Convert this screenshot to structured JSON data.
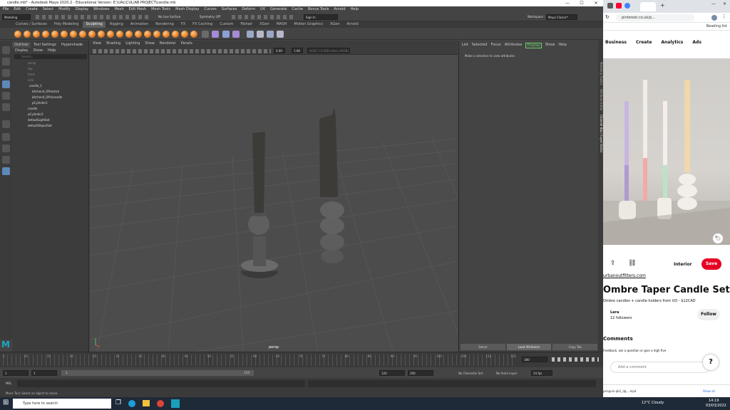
{
  "maya": {
    "title": "candle.mb* - Autodesk Maya 2020.2 - Educational Version: E:\\UAL\\CUL\\AB PROJECT\\candle.mb",
    "menubar": [
      "File",
      "Edit",
      "Create",
      "Select",
      "Modify",
      "Display",
      "Windows",
      "Mesh",
      "Edit Mesh",
      "Mesh Tools",
      "Mesh Display",
      "Curves",
      "Surfaces",
      "Deform",
      "UV",
      "Generate",
      "Cache",
      "Bonus Tools",
      "Arnold",
      "Help"
    ],
    "status": {
      "mode": "Modeling",
      "live_surface": "No Live Surface",
      "symmetry": "Symmetry: Off",
      "signin": "Sign In",
      "workspace_label": "Workspace :",
      "workspace": "Maya Classic*"
    },
    "shelf_tabs": [
      "Curves / Surfaces",
      "Poly Modeling",
      "Sculpting",
      "Rigging",
      "Animation",
      "Rendering",
      "FX",
      "FX Caching",
      "Custom",
      "Fibhair",
      "XGen",
      "MASH",
      "Motion Graphics",
      "XGen",
      "Arnold"
    ],
    "shelf_active": 2,
    "outliner": {
      "tabs": [
        "Outliner",
        "Tool Settings",
        "Hypershade"
      ],
      "menu": [
        "Display",
        "Show",
        "Help"
      ],
      "search_placeholder": "Search...",
      "items": [
        "persp",
        "top",
        "front",
        "side",
        "candle_1",
        "kitchen4_Ofirkstick",
        "kitchen4_Ofirkcandle",
        "pCylinder1",
        "candle",
        "pCylinder2",
        "defaultLightSet",
        "defaultObjectSet"
      ]
    },
    "viewport": {
      "menu": [
        "View",
        "Shading",
        "Lighting",
        "Show",
        "Renderer",
        "Panels"
      ],
      "camera_label": "persp",
      "field1": "0.00",
      "field2": "1.00",
      "colorspace": "ACES 1.0 SDR-video (sRGB)"
    },
    "attribute_editor": {
      "tabs": [
        "List",
        "Selected",
        "Focus",
        "Attributes",
        "Display",
        "Show",
        "Help"
      ],
      "active_tab": 4,
      "message": "Make a selection to view attributes",
      "buttons": [
        "Select",
        "Load Attributes",
        "Copy Tab"
      ]
    },
    "right_tabs": [
      "Modeling Toolkit",
      "Attribute Editor",
      "Channel Box / Layer Editor"
    ],
    "timeline": {
      "ticks": [
        "5",
        "10",
        "15",
        "20",
        "25",
        "30",
        "35",
        "40",
        "45",
        "50",
        "55",
        "60",
        "65",
        "70",
        "75",
        "80",
        "85",
        "90",
        "95",
        "100",
        "105",
        "110",
        "115"
      ],
      "current_frame": "180"
    },
    "range": {
      "start": "1",
      "start2": "1",
      "mid": "1",
      "end_inner": "120",
      "end1": "120",
      "end2": "200",
      "character_set": "No Character Set",
      "anim_layer": "No Anim Layer",
      "fps": "24 fps"
    },
    "mel_label": "MEL",
    "help_line": "Move Tool: Select an object to move."
  },
  "browser": {
    "omnibox": "pinterest.co.uk/p...",
    "reading_list": "Reading list",
    "nav": [
      "Business",
      "Create",
      "Analytics",
      "Ads"
    ],
    "interior": "Interior",
    "save": "Save",
    "source": "urbanoutfitters.com",
    "title": "Ombre Taper Candle Set",
    "description": "Ombre candles + candle holders from UO - $12CAD",
    "author": "Lara",
    "followers": "12 followers",
    "follow": "Follow",
    "comments": "Comments",
    "comments_hint": "Feedback, ask a question or give a high five",
    "add_comment": "Add a comment",
    "download": "penguin-pb1_dg....mp4",
    "show_all": "Show all"
  },
  "taskbar": {
    "search": "Type here to search",
    "weather": "12°C  Cloudy",
    "time": "14:19",
    "date": "03/03/2022"
  }
}
